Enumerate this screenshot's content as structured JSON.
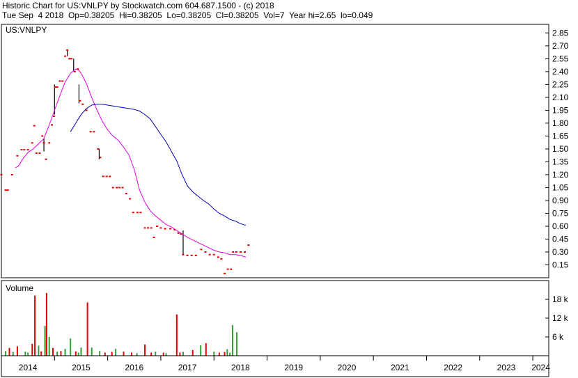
{
  "header": {
    "title_line": "Historic Chart for US:VNLPY by Stockwatch.com 604.687.1500 - (c) 2018",
    "quote_line": "Tue Sep  4 2018  Op=0.38205  Hi=0.38205  Lo=0.38205  Cl=0.38205  Vol=7  Year hi=2.65  lo=0.049"
  },
  "colors": {
    "up": "#e00000",
    "hilo": "#000000",
    "ma_short": "#e000e0",
    "ma_long": "#0000c0",
    "vol_up": "#30a030",
    "vol_down": "#e00000"
  },
  "chart_data": [
    {
      "type": "line",
      "panel": "price",
      "title": "US:VNLPY",
      "xlabel": "",
      "ylabel": "",
      "xlim": [
        2014.0,
        2024.3
      ],
      "ylim": [
        0.0,
        2.95
      ],
      "y_ticks": [
        "2.85",
        "2.70",
        "2.55",
        "2.40",
        "2.25",
        "2.10",
        "1.95",
        "1.80",
        "1.65",
        "1.50",
        "1.35",
        "1.20",
        "1.05",
        "0.90",
        "0.75",
        "0.60",
        "0.45",
        "0.30",
        "0.15"
      ],
      "grid": false,
      "series": [
        {
          "kind": "price_marks",
          "values": [
            [
              2014.0,
              1.2
            ],
            [
              2014.08,
              1.02
            ],
            [
              2014.12,
              1.02
            ],
            [
              2014.2,
              1.2
            ],
            [
              2014.3,
              1.42
            ],
            [
              2014.38,
              1.49
            ],
            [
              2014.43,
              1.49
            ],
            [
              2014.5,
              1.49
            ],
            [
              2014.58,
              1.57
            ],
            [
              2014.62,
              1.77
            ],
            [
              2014.66,
              1.45
            ],
            [
              2014.72,
              1.45
            ],
            [
              2014.77,
              1.65
            ],
            [
              2014.8,
              1.57
            ],
            [
              2014.84,
              1.38
            ],
            [
              2014.9,
              1.57
            ],
            [
              2014.95,
              1.78
            ],
            [
              2014.99,
              1.88
            ],
            [
              2015.01,
              2.22
            ],
            [
              2015.05,
              2.22
            ],
            [
              2015.1,
              2.29
            ],
            [
              2015.15,
              2.29
            ],
            [
              2015.2,
              2.58
            ],
            [
              2015.24,
              2.65
            ],
            [
              2015.28,
              2.55
            ],
            [
              2015.32,
              2.55
            ],
            [
              2015.38,
              2.4
            ],
            [
              2015.44,
              2.43
            ],
            [
              2015.48,
              2.06
            ],
            [
              2015.53,
              2.02
            ],
            [
              2015.6,
              1.95
            ],
            [
              2015.68,
              1.7
            ],
            [
              2015.74,
              1.7
            ],
            [
              2015.82,
              1.5
            ],
            [
              2015.86,
              1.4
            ],
            [
              2015.92,
              1.18
            ],
            [
              2015.98,
              1.18
            ],
            [
              2016.04,
              1.18
            ],
            [
              2016.1,
              1.05
            ],
            [
              2016.17,
              1.05
            ],
            [
              2016.22,
              1.05
            ],
            [
              2016.28,
              1.05
            ],
            [
              2016.35,
              0.98
            ],
            [
              2016.42,
              0.92
            ],
            [
              2016.48,
              0.76
            ],
            [
              2016.56,
              0.76
            ],
            [
              2016.62,
              0.76
            ],
            [
              2016.7,
              0.58
            ],
            [
              2016.76,
              0.58
            ],
            [
              2016.82,
              0.58
            ],
            [
              2016.87,
              0.47
            ],
            [
              2016.93,
              0.6
            ],
            [
              2017.0,
              0.58
            ],
            [
              2017.08,
              0.57
            ],
            [
              2017.18,
              0.57
            ],
            [
              2017.26,
              0.56
            ],
            [
              2017.33,
              0.52
            ],
            [
              2017.38,
              0.51
            ],
            [
              2017.42,
              0.27
            ],
            [
              2017.5,
              0.26
            ],
            [
              2017.58,
              0.26
            ],
            [
              2017.66,
              0.26
            ],
            [
              2017.76,
              0.33
            ],
            [
              2017.84,
              0.3
            ],
            [
              2017.92,
              0.27
            ],
            [
              2018.0,
              0.27
            ],
            [
              2018.08,
              0.24
            ],
            [
              2018.14,
              0.22
            ],
            [
              2018.2,
              0.05
            ],
            [
              2018.26,
              0.1
            ],
            [
              2018.32,
              0.1
            ],
            [
              2018.36,
              0.3
            ],
            [
              2018.42,
              0.3
            ],
            [
              2018.5,
              0.3
            ],
            [
              2018.58,
              0.3
            ],
            [
              2018.65,
              0.38
            ]
          ],
          "hilo_segments": [
            [
              2014.8,
              1.47,
              1.62
            ],
            [
              2015.0,
              1.9,
              2.25
            ],
            [
              2015.36,
              2.4,
              2.55
            ],
            [
              2015.46,
              2.03,
              2.25
            ],
            [
              2015.84,
              1.38,
              1.5
            ],
            [
              2017.42,
              0.26,
              0.55
            ],
            [
              2015.24,
              2.58,
              2.65
            ]
          ]
        },
        {
          "name": "",
          "kind": "ma_short",
          "x": [
            2014.0,
            2014.05,
            2014.12,
            2014.2,
            2014.26,
            2014.32,
            2014.4,
            2014.5,
            2014.6,
            2014.7,
            2014.8,
            2014.9,
            2015.0,
            2015.1,
            2015.2,
            2015.3,
            2015.4,
            2015.45,
            2015.5,
            2015.6,
            2015.7,
            2015.8,
            2015.9,
            2016.0,
            2016.1,
            2016.2,
            2016.3,
            2016.4,
            2016.5,
            2016.6,
            2016.7,
            2016.8,
            2016.9,
            2017.0,
            2017.1,
            2017.2,
            2017.3,
            2017.4,
            2017.5,
            2017.6,
            2017.7,
            2017.8,
            2017.9,
            2018.0,
            2018.1,
            2018.2,
            2018.3,
            2018.4,
            2018.5,
            2018.6
          ],
          "values": [
            0.0,
            0.0,
            0.0,
            0.0,
            1.28,
            1.3,
            1.38,
            1.46,
            1.5,
            1.56,
            1.62,
            1.78,
            1.95,
            2.12,
            2.28,
            2.38,
            2.43,
            2.42,
            2.38,
            2.26,
            2.1,
            1.95,
            1.82,
            1.72,
            1.65,
            1.6,
            1.52,
            1.43,
            1.26,
            1.02,
            0.88,
            0.78,
            0.72,
            0.67,
            0.62,
            0.59,
            0.55,
            0.51,
            0.47,
            0.44,
            0.41,
            0.38,
            0.35,
            0.32,
            0.3,
            0.29,
            0.27,
            0.27,
            0.26,
            0.24
          ]
        },
        {
          "name": "",
          "kind": "ma_long",
          "x": [
            2014.6,
            2014.7,
            2014.8,
            2014.9,
            2015.0,
            2015.1,
            2015.2,
            2015.3,
            2015.4,
            2015.5,
            2015.6,
            2015.7,
            2015.8,
            2015.9,
            2016.0,
            2016.1,
            2016.2,
            2016.3,
            2016.4,
            2016.5,
            2016.6,
            2016.7,
            2016.8,
            2016.9,
            2017.0,
            2017.1,
            2017.2,
            2017.3,
            2017.4,
            2017.5,
            2017.6,
            2017.7,
            2017.8,
            2017.9,
            2018.0,
            2018.1,
            2018.2,
            2018.3,
            2018.4,
            2018.5,
            2018.6
          ],
          "values": [
            0.0,
            0.0,
            0.0,
            0.0,
            0.0,
            0.0,
            0.0,
            1.7,
            1.8,
            1.9,
            1.97,
            2.01,
            2.02,
            2.02,
            2.01,
            2.0,
            1.99,
            1.98,
            1.97,
            1.96,
            1.94,
            1.9,
            1.85,
            1.76,
            1.67,
            1.58,
            1.47,
            1.36,
            1.2,
            1.07,
            1.0,
            0.95,
            0.9,
            0.86,
            0.8,
            0.75,
            0.72,
            0.68,
            0.66,
            0.63,
            0.61
          ]
        }
      ]
    },
    {
      "type": "bar",
      "panel": "volume",
      "title": "Volume",
      "xlabel": "",
      "ylabel": "",
      "xlim": [
        2014.0,
        2024.3
      ],
      "ylim": [
        0,
        24000
      ],
      "y_ticks": [
        "18 k",
        "12 k",
        "6 k"
      ],
      "x_tick_labels": [
        "2014",
        "2015",
        "2016",
        "2017",
        "2018",
        "2019",
        "2020",
        "2021",
        "2022",
        "2023",
        "2024"
      ],
      "x": [
        2014.08,
        2014.15,
        2014.22,
        2014.3,
        2014.45,
        2014.5,
        2014.58,
        2014.63,
        2014.7,
        2014.75,
        2014.82,
        2014.85,
        2014.9,
        2014.97,
        2015.05,
        2015.12,
        2015.2,
        2015.3,
        2015.4,
        2015.45,
        2015.5,
        2015.62,
        2015.7,
        2015.85,
        2015.95,
        2016.08,
        2016.15,
        2016.3,
        2016.45,
        2016.55,
        2016.7,
        2016.82,
        2016.9,
        2017.05,
        2017.1,
        2017.3,
        2017.36,
        2017.42,
        2017.6,
        2017.75,
        2017.85,
        2018.0,
        2018.1,
        2018.2,
        2018.25,
        2018.3,
        2018.35,
        2018.43
      ],
      "values": [
        1500,
        2500,
        1200,
        3000,
        1300,
        1000,
        3800,
        19200,
        3200,
        1400,
        9500,
        20000,
        6000,
        2500,
        1300,
        1500,
        2200,
        5500,
        1400,
        1000,
        2600,
        17000,
        2600,
        1500,
        1000,
        1200,
        2200,
        1300,
        1000,
        800,
        3600,
        1000,
        1300,
        1000,
        800,
        13200,
        1000,
        1200,
        1800,
        3300,
        4000,
        1300,
        1000,
        1200,
        2100,
        1000,
        9800,
        7500,
        1000,
        2200,
        5800,
        1000,
        900,
        1600,
        1200
      ],
      "colors": [
        "green",
        "red",
        "green",
        "red",
        "green",
        "green",
        "red",
        "red",
        "green",
        "red",
        "green",
        "red",
        "green",
        "red",
        "green",
        "red",
        "green",
        "green",
        "red",
        "green",
        "green",
        "red",
        "green",
        "green",
        "red",
        "red",
        "green",
        "red",
        "red",
        "green",
        "red",
        "red",
        "green",
        "red",
        "green",
        "red",
        "red",
        "green",
        "red",
        "green",
        "red",
        "green",
        "red",
        "red",
        "green",
        "green",
        "green",
        "green"
      ]
    }
  ]
}
